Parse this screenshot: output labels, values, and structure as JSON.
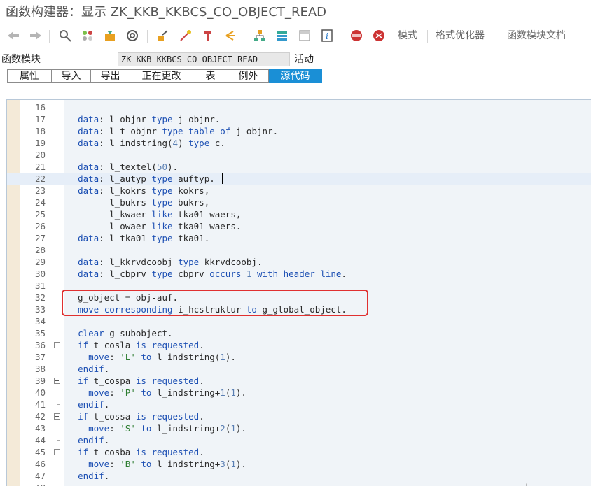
{
  "window": {
    "title": "函数构建器：显示 ZK_KKB_KKBCS_CO_OBJECT_READ"
  },
  "toolbar": {
    "icons": [
      "back-arrow-icon",
      "forward-arrow-icon",
      "display-change-icon",
      "other-object-icon",
      "activate-icon",
      "where-used-icon",
      "check-icon",
      "navigate-icon",
      "wand-icon",
      "test-icon",
      "hierarchy-icon",
      "pretty-print-icon",
      "frame-icon",
      "info-icon",
      "breakpoint-icon",
      "session-breakpoint-icon"
    ],
    "mode_label": "模式",
    "pretty_printer_label": "格式优化器",
    "fm_doc_label": "函数模块文档"
  },
  "function_module": {
    "label": "函数模块",
    "name": "ZK_KKB_KKBCS_CO_OBJECT_READ",
    "status": "活动"
  },
  "tabs": [
    {
      "label": "属性"
    },
    {
      "label": "导入"
    },
    {
      "label": "导出"
    },
    {
      "label": "正在更改"
    },
    {
      "label": "表"
    },
    {
      "label": "例外"
    },
    {
      "label": "源代码",
      "active": true
    }
  ],
  "colors": {
    "keyword": "#1c4fb3",
    "number": "#5a7fb3",
    "string": "#2e7d32",
    "active_tab": "#1a8fd6",
    "highlight_box": "#e03030"
  },
  "editor": {
    "highlight_line": 22,
    "lines": [
      {
        "n": "16",
        "t": ""
      },
      {
        "n": "17",
        "t": "  data: l_objnr type j_objnr."
      },
      {
        "n": "18",
        "t": "  data: l_t_objnr type table of j_objnr."
      },
      {
        "n": "19",
        "t": "  data: l_indstring(4) type c."
      },
      {
        "n": "20",
        "t": ""
      },
      {
        "n": "21",
        "t": "  data: l_textel(50)."
      },
      {
        "n": "22",
        "t": "  data: l_autyp type auftyp."
      },
      {
        "n": "23",
        "t": "  data: l_kokrs type kokrs,"
      },
      {
        "n": "24",
        "t": "        l_bukrs type bukrs,"
      },
      {
        "n": "25",
        "t": "        l_kwaer like tka01-waers,"
      },
      {
        "n": "26",
        "t": "        l_owaer like tka01-waers."
      },
      {
        "n": "27",
        "t": "  data: l_tka01 type tka01."
      },
      {
        "n": "28",
        "t": ""
      },
      {
        "n": "29",
        "t": "  data: l_kkrvdcoobj type kkrvdcoobj."
      },
      {
        "n": "30",
        "t": "  data: l_cbprv type cbprv occurs 1 with header line."
      },
      {
        "n": "31",
        "t": ""
      },
      {
        "n": "32",
        "t": "  g_object = obj-auf."
      },
      {
        "n": "33",
        "t": "  move-corresponding i_hcstruktur to g_global_object."
      },
      {
        "n": "34",
        "t": ""
      },
      {
        "n": "35",
        "t": "  clear g_subobject."
      },
      {
        "n": "36",
        "t": "  if t_cosla is requested."
      },
      {
        "n": "37",
        "t": "    move: 'L' to l_indstring(1)."
      },
      {
        "n": "38",
        "t": "  endif."
      },
      {
        "n": "39",
        "t": "  if t_cospa is requested."
      },
      {
        "n": "40",
        "t": "    move: 'P' to l_indstring+1(1)."
      },
      {
        "n": "41",
        "t": "  endif."
      },
      {
        "n": "42",
        "t": "  if t_cossa is requested."
      },
      {
        "n": "43",
        "t": "    move: 'S' to l_indstring+2(1)."
      },
      {
        "n": "44",
        "t": "  endif."
      },
      {
        "n": "45",
        "t": "  if t_cosba is requested."
      },
      {
        "n": "46",
        "t": "    move: 'B' to l_indstring+3(1)."
      },
      {
        "n": "47",
        "t": "  endif."
      },
      {
        "n": "48",
        "t": ""
      }
    ]
  }
}
